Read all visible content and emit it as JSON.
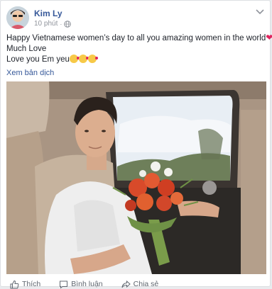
{
  "post": {
    "author_name": "Kim Ly",
    "time": "10 phút",
    "separator": "·",
    "lines": [
      "Happy Vietnamese women’s day to all you amazing women in the world",
      "Much Love",
      "Love you Em yeu"
    ],
    "see_translation": "Xem bản dịch"
  },
  "actions": {
    "like": "Thích",
    "comment": "Bình luận",
    "share": "Chia sẻ"
  },
  "icons": {
    "avatar": "profile-photo",
    "privacy": "globe-icon",
    "options": "chevron-down-icon",
    "heart": "heart-emoji",
    "kiss": "face-blowing-kiss-emoji",
    "like": "thumbs-up-icon",
    "comment": "comment-icon",
    "share": "share-arrow-icon"
  },
  "colors": {
    "link": "#365899",
    "meta": "#90949c",
    "text": "#1d2129",
    "heart": "#e0245e"
  }
}
